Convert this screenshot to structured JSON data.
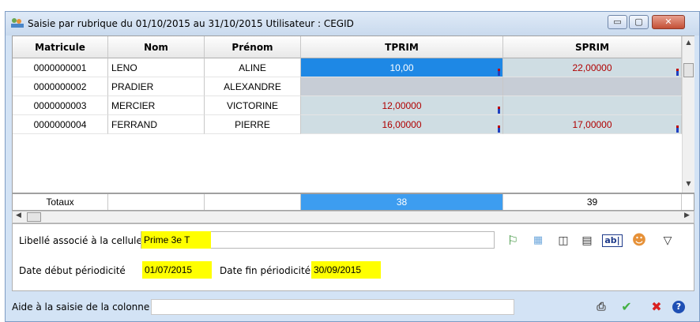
{
  "window": {
    "title": "Saisie par rubrique du 01/10/2015 au 31/10/2015 Utilisateur : CEGID",
    "minimize_glyph": "▭",
    "maximize_glyph": "▢",
    "close_glyph": "✕"
  },
  "grid": {
    "columns": [
      "Matricule",
      "Nom",
      "Prénom",
      "TPRIM",
      "SPRIM"
    ],
    "rows": [
      {
        "matricule": "0000000001",
        "nom": "LENO",
        "prenom": "ALINE",
        "tprim": "10,00",
        "sprim": "22,00000"
      },
      {
        "matricule": "0000000002",
        "nom": "PRADIER",
        "prenom": "ALEXANDRE",
        "tprim": "",
        "sprim": ""
      },
      {
        "matricule": "0000000003",
        "nom": "MERCIER",
        "prenom": "VICTORINE",
        "tprim": "12,00000",
        "sprim": ""
      },
      {
        "matricule": "0000000004",
        "nom": "FERRAND",
        "prenom": "PIERRE",
        "tprim": "16,00000",
        "sprim": "17,00000"
      }
    ],
    "totals": {
      "label": "Totaux",
      "tprim": "38",
      "sprim": "39"
    }
  },
  "form": {
    "libelle_label": "Libellé associé à la cellule",
    "libelle_value": "Prime 3e T",
    "date_debut_label": "Date début périodicité",
    "date_debut_value": "01/07/2015",
    "date_fin_label": "Date fin périodicité",
    "date_fin_value": "30/09/2015"
  },
  "toolbar": {
    "icons": [
      "runner-icon",
      "grid-icon",
      "column-icon",
      "columns-icon",
      "textfield-icon",
      "users-icon",
      "filter-icon"
    ]
  },
  "status": {
    "aide_label": "Aide à la saisie de la colonne",
    "aide_value": ""
  },
  "colors": {
    "accent_selection": "#1e88e5",
    "highlight_yellow": "#ffff00",
    "value_red": "#b00000"
  }
}
